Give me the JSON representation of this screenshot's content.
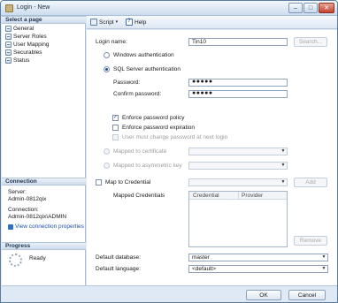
{
  "window": {
    "title": "Login - New"
  },
  "left": {
    "select_page_header": "Select a page",
    "pages": [
      "General",
      "Server Roles",
      "User Mapping",
      "Securables",
      "Status"
    ],
    "connection_header": "Connection",
    "server_label": "Server:",
    "server_value": "Admin-0812qix",
    "connection_label": "Connection:",
    "connection_value": "Admin-0812qix\\ADMIN",
    "view_props_link": "View connection properties",
    "progress_header": "Progress",
    "progress_status": "Ready"
  },
  "toolbar": {
    "script_label": "Script",
    "help_label": "Help"
  },
  "form": {
    "login_name_label": "Login name:",
    "login_name_value": "Tin10",
    "search_button": "Search...",
    "windows_auth_label": "Windows authentication",
    "sql_auth_label": "SQL Server authentication",
    "password_label": "Password:",
    "password_value": "●●●●●",
    "confirm_password_label": "Confirm password:",
    "confirm_password_value": "●●●●●",
    "enforce_policy_label": "Enforce password policy",
    "enforce_expiration_label": "Enforce password expiration",
    "must_change_label": "User must change password at next login",
    "mapped_cert_label": "Mapped to certificate",
    "mapped_key_label": "Mapped to asymmetric key",
    "map_credential_label": "Map to Credential",
    "add_button": "Add",
    "mapped_credentials_label": "Mapped Credentials",
    "grid_columns": [
      "Credential",
      "Provider"
    ],
    "remove_button": "Remove",
    "default_db_label": "Default database:",
    "default_db_value": "master",
    "default_lang_label": "Default language:",
    "default_lang_value": "<default>"
  },
  "buttons": {
    "ok": "OK",
    "cancel": "Cancel"
  },
  "window_controls": {
    "minimize": "–",
    "maximize": "□",
    "close": "✕"
  }
}
